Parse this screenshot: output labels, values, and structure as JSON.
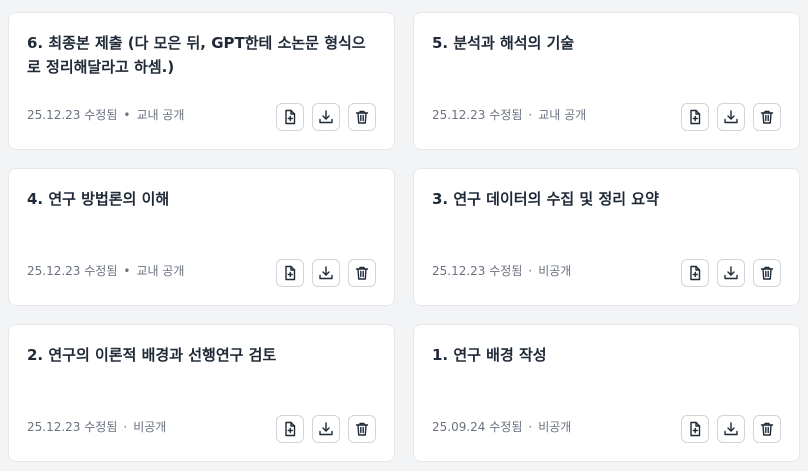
{
  "cards": [
    {
      "title": "6. 최종본 제출 (다 모은 뒤, GPT한테 소논문 형식으로 정리해달라고 하셈.)",
      "date": "25.12.23 수정됨",
      "separator": "•",
      "visibility": "교내 공개"
    },
    {
      "title": "5. 분석과 해석의 기술",
      "date": "25.12.23 수정됨",
      "separator": "·",
      "visibility": "교내 공개"
    },
    {
      "title": "4. 연구 방법론의 이해",
      "date": "25.12.23 수정됨",
      "separator": "•",
      "visibility": "교내 공개"
    },
    {
      "title": "3. 연구 데이터의 수집 및 정리 요약",
      "date": "25.12.23 수정됨",
      "separator": "·",
      "visibility": "비공개"
    },
    {
      "title": "2. 연구의 이론적 배경과 선행연구 검토",
      "date": "25.12.23 수정됨",
      "separator": "·",
      "visibility": "비공개"
    },
    {
      "title": "1. 연구 배경 작성",
      "date": "25.09.24 수정됨",
      "separator": "·",
      "visibility": "비공개"
    }
  ],
  "icons": {
    "add_file": "file-plus-icon",
    "download": "download-icon",
    "delete": "trash-icon"
  }
}
